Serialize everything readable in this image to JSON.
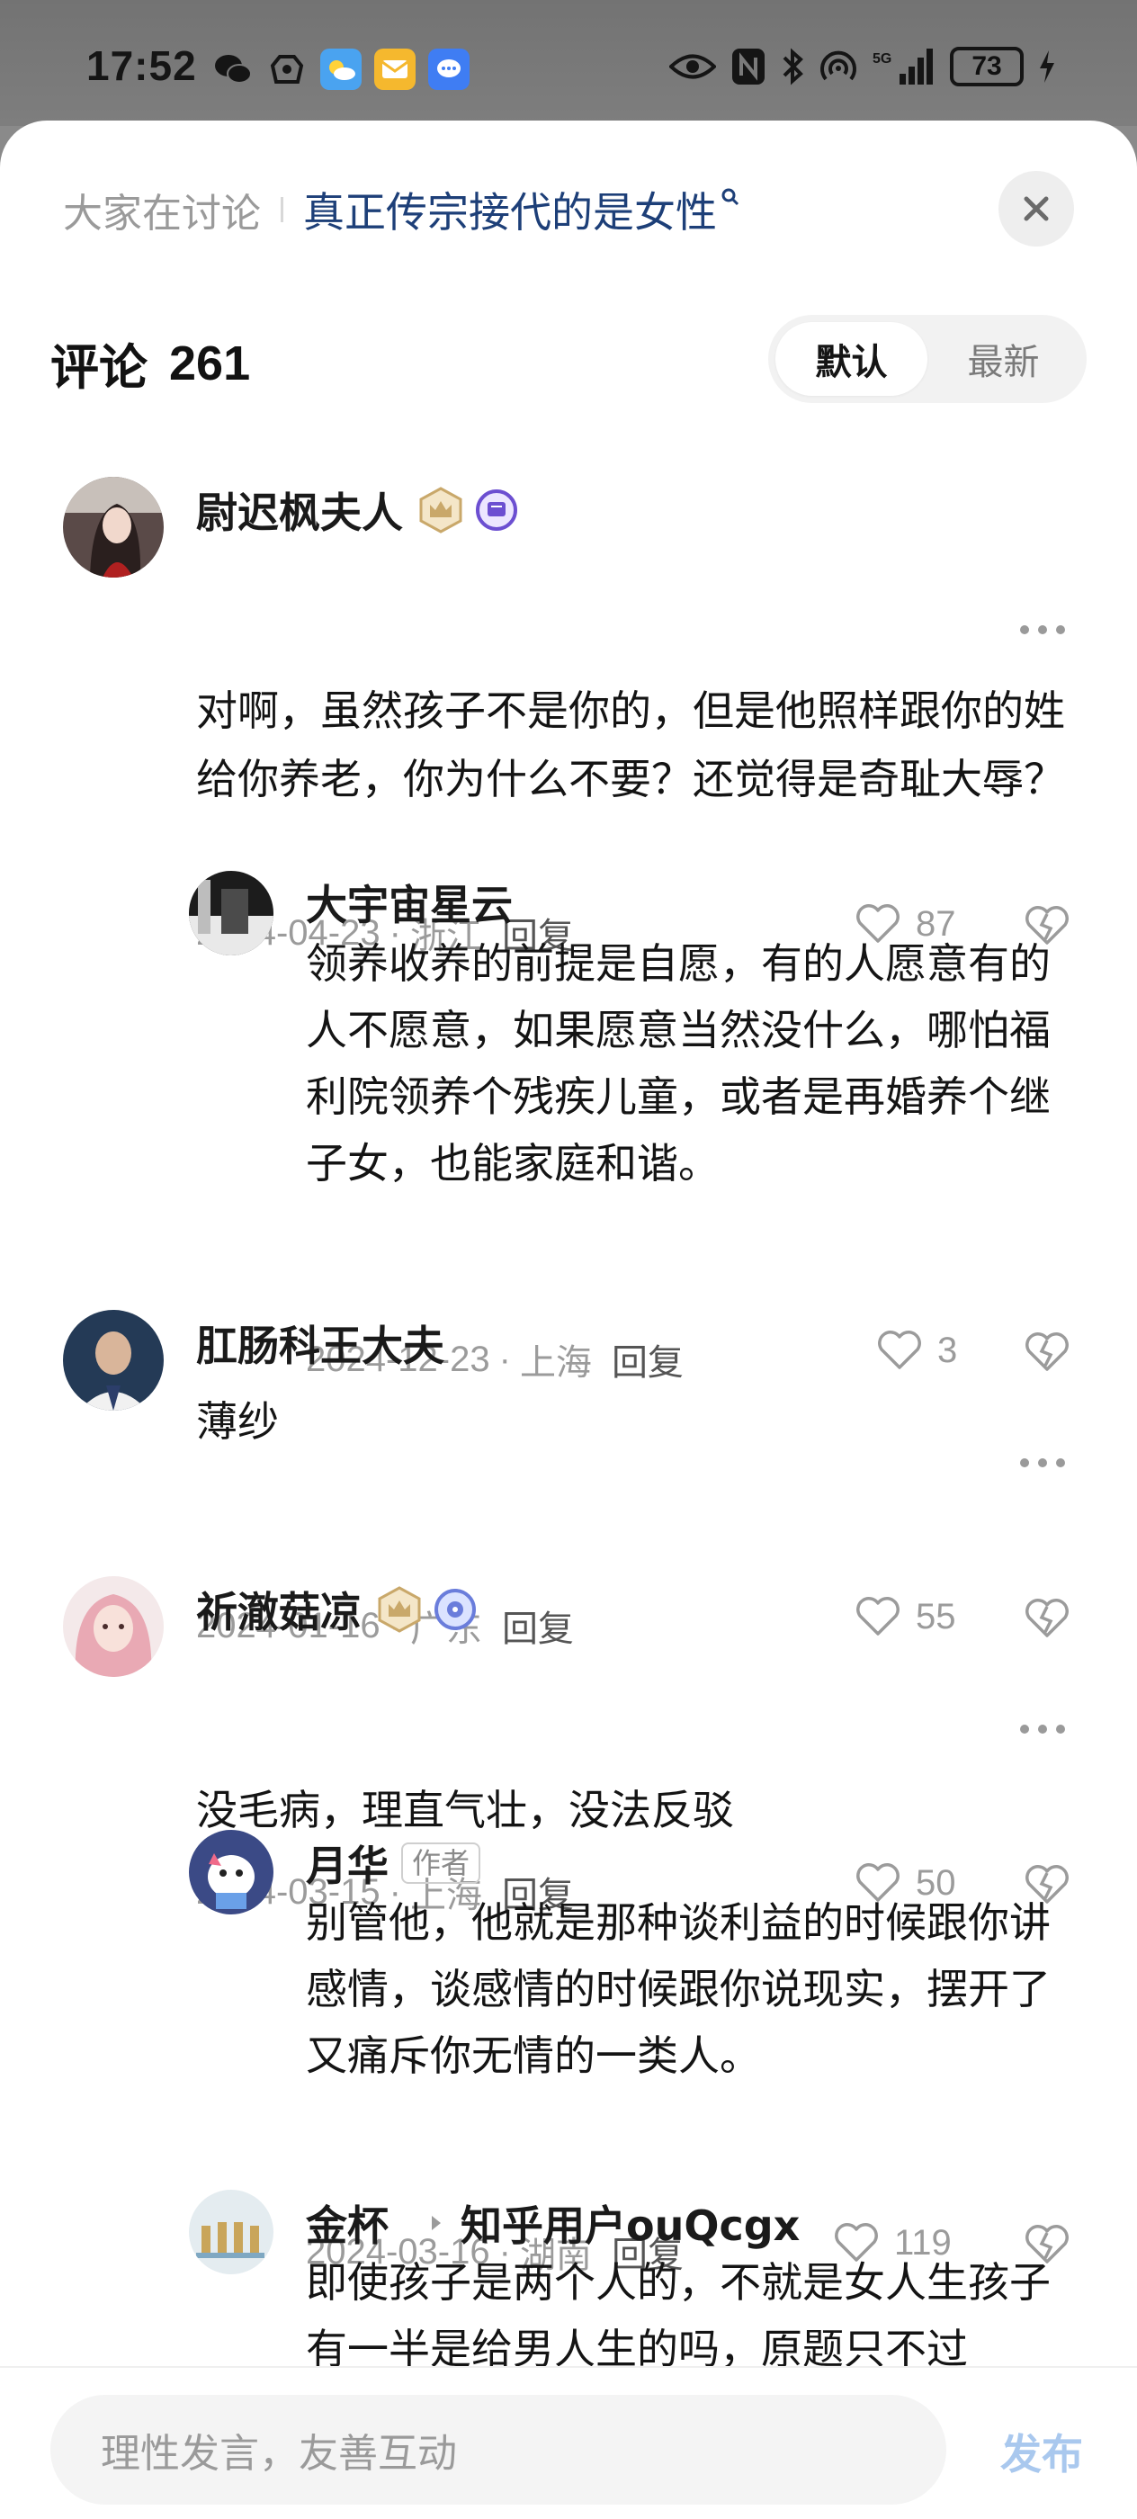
{
  "status_bar": {
    "time": "17:52",
    "battery": "73",
    "network": "5G"
  },
  "header": {
    "topic_label": "大家在讨论",
    "topic_title": "真正传宗接代的是女性",
    "topic_search_mark": "Q"
  },
  "comments_section": {
    "label": "评论",
    "count": "261",
    "sort_options": [
      "默认",
      "最新"
    ],
    "sort_selected": "默认"
  },
  "comments": [
    {
      "name": "尉迟枫夫人",
      "text": "对啊，虽然孩子不是你的，但是他照样跟你的姓给你养老，你为什么不要？还觉得是奇耻大辱？",
      "date": "2024-04-23",
      "location": "浙江",
      "reply_label": "回复",
      "likes": "87"
    },
    {
      "name": "大宇宙星云",
      "text": "领养收养的前提是自愿，有的人愿意有的人不愿意，如果愿意当然没什么，哪怕福利院领养个残疾儿童，或者是再婚养个继子女，也能家庭和谐。",
      "date": "2024-12-23",
      "location": "上海",
      "reply_label": "回复",
      "likes": "3"
    },
    {
      "name": "肛肠科王大夫",
      "text": "薄纱",
      "date": "2024-01-16",
      "location": "广东",
      "reply_label": "回复",
      "likes": "55"
    },
    {
      "name": "祈澈菇凉",
      "text": "没毛病，理直气壮，没法反驳",
      "date": "2024-03-15",
      "location": "上海",
      "reply_label": "回复",
      "likes": "50"
    },
    {
      "name": "月华",
      "author_tag": "作者",
      "text": "别管他，他就是那种谈利益的时候跟你讲感情，谈感情的时候跟你说现实，摆开了又痛斥你无情的一类人。",
      "date": "2024-03-16",
      "location": "湖南",
      "reply_label": "回复",
      "likes": "119"
    },
    {
      "name": "金杯",
      "reply_to": "知乎用户ouQcgx",
      "text": "即使孩子是两个人的，不就是女人生孩子有一半是给男人生的吗，原题只不过"
    }
  ],
  "input_bar": {
    "placeholder": "理性发言，友善互动",
    "publish_label": "发布"
  },
  "colors": {
    "topic_blue": "#1d3f78",
    "publish_disabled": "#a9c8ee",
    "crown_gold": "#c9a86a",
    "badge_purple": "#6c4fd1"
  }
}
